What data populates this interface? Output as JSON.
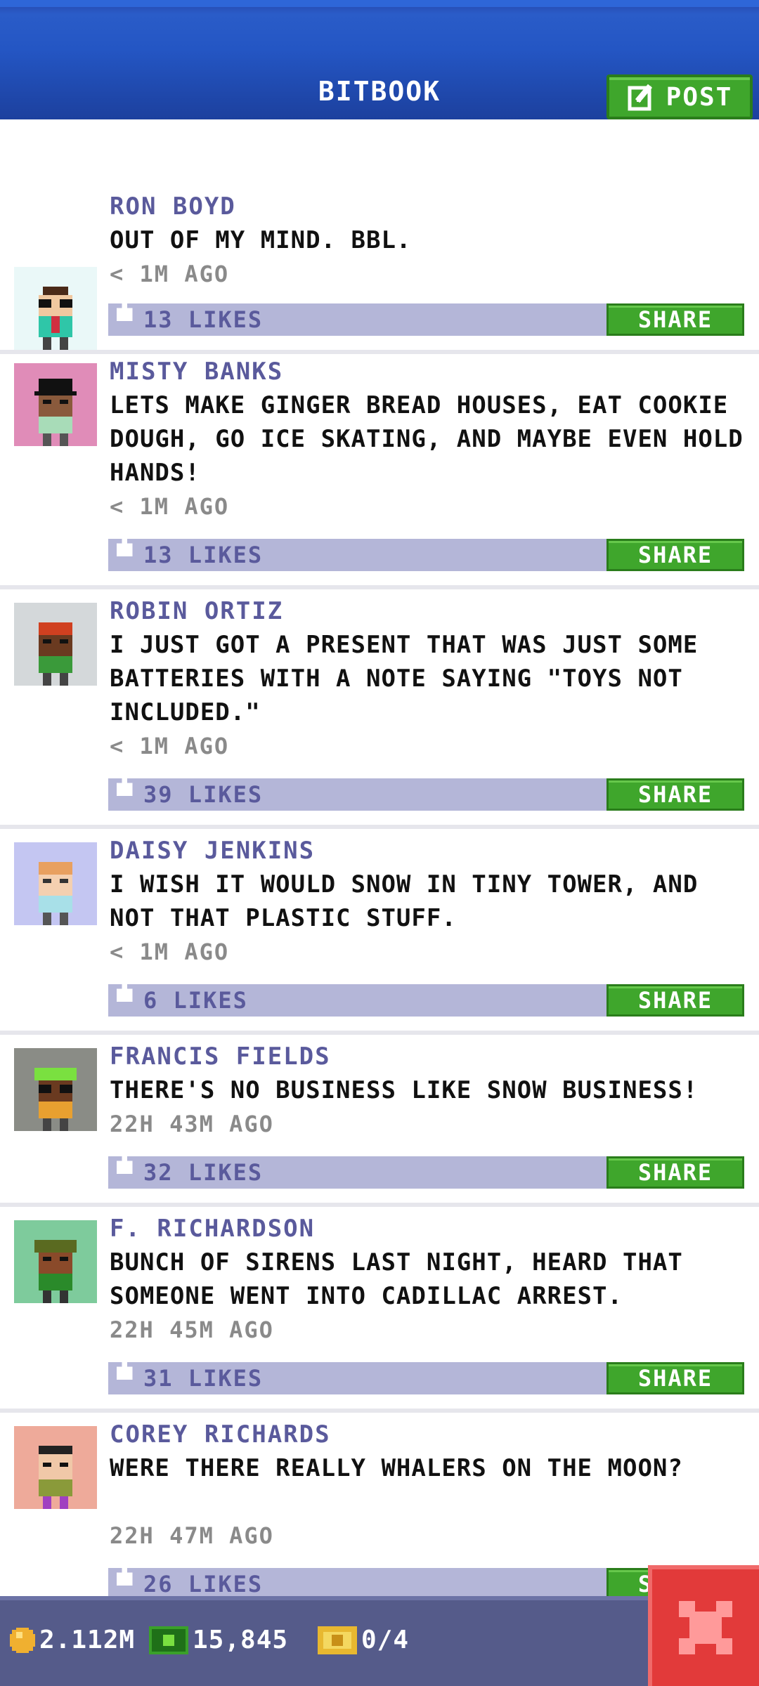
{
  "header": {
    "title": "BITBOOK",
    "post_label": "POST"
  },
  "posts": [
    {
      "name": "RON BOYD",
      "message": "OUT OF MY MIND. BBL.",
      "time": "< 1M AGO",
      "likes": "13 LIKES",
      "share": "SHARE",
      "avatar_bg": "#eaf8f8"
    },
    {
      "name": "MISTY BANKS",
      "message": "LETS MAKE GINGER BREAD HOUSES, EAT COOKIE DOUGH, GO ICE SKATING, AND MAYBE EVEN HOLD HANDS!",
      "time": "< 1M AGO",
      "likes": "13 LIKES",
      "share": "SHARE",
      "avatar_bg": "#e08cb8"
    },
    {
      "name": "ROBIN ORTIZ",
      "message": "I JUST GOT A PRESENT THAT WAS JUST SOME BATTERIES WITH A NOTE SAYING \"TOYS NOT INCLUDED.\"",
      "time": "< 1M AGO",
      "likes": "39 LIKES",
      "share": "SHARE",
      "avatar_bg": "#d4d8da"
    },
    {
      "name": "DAISY JENKINS",
      "message": "I WISH IT WOULD SNOW IN TINY TOWER, AND NOT THAT PLASTIC STUFF.",
      "time": "< 1M AGO",
      "likes": "6 LIKES",
      "share": "SHARE",
      "avatar_bg": "#c4c6f2"
    },
    {
      "name": "FRANCIS FIELDS",
      "message": "THERE'S NO BUSINESS LIKE SNOW BUSINESS!",
      "time": "22H 43M AGO",
      "likes": "32 LIKES",
      "share": "SHARE",
      "avatar_bg": "#8a8c86"
    },
    {
      "name": "F. RICHARDSON",
      "message": "BUNCH OF SIRENS LAST NIGHT, HEARD THAT SOMEONE WENT INTO CADILLAC ARREST.",
      "time": "22H 45M AGO",
      "likes": "31 LIKES",
      "share": "SHARE",
      "avatar_bg": "#7ecb9c"
    },
    {
      "name": "COREY RICHARDS",
      "message": "WERE THERE REALLY WHALERS ON THE MOON?",
      "time": "22H 47M AGO",
      "likes": "26 LIKES",
      "share": "SHARE",
      "avatar_bg": "#eeaa9a"
    }
  ],
  "bottom_bar": {
    "coins": "2.112M",
    "bux": "15,845",
    "tickets": "0/4"
  },
  "colors": {
    "header_blue": "#2456c4",
    "share_green": "#3fa62c",
    "like_bar": "#b4b6d8",
    "close_red": "#e23a3a"
  }
}
